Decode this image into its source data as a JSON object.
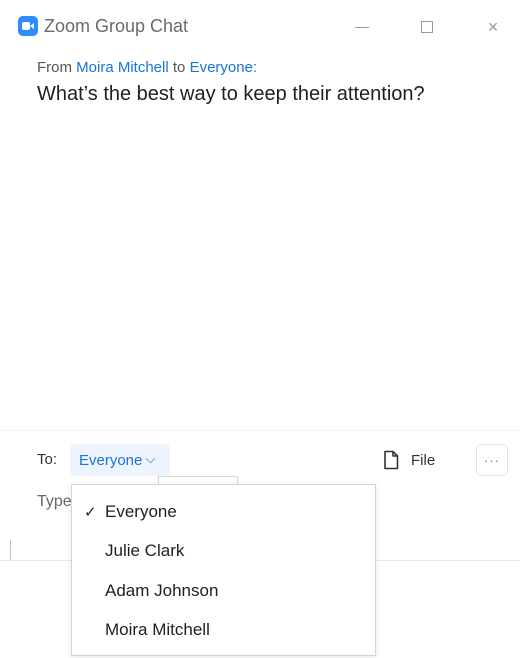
{
  "window": {
    "title": "Zoom Group Chat",
    "icons": {
      "app": "zoom-camera-icon",
      "minimize": "minimize-icon",
      "maximize": "maximize-icon",
      "close": "close-icon"
    }
  },
  "message": {
    "from_prefix": "From",
    "sender": "Moira Mitchell",
    "to_word": "to",
    "recipient": "Everyone:",
    "text": "What’s the best way to keep their attention?"
  },
  "compose": {
    "to_label": "To:",
    "selected_recipient": "Everyone",
    "file_label": "File",
    "more_label": "···",
    "input_placeholder": "Type"
  },
  "recipient_menu": {
    "items": [
      {
        "label": "Everyone",
        "checked": true
      },
      {
        "label": "Julie Clark",
        "checked": false
      },
      {
        "label": "Adam Johnson",
        "checked": false
      },
      {
        "label": "Moira Mitchell",
        "checked": false
      }
    ],
    "check_glyph": "✓"
  },
  "colors": {
    "accent": "#2d8cff",
    "link": "#1a73d9",
    "select_bg": "#eef4fd"
  }
}
